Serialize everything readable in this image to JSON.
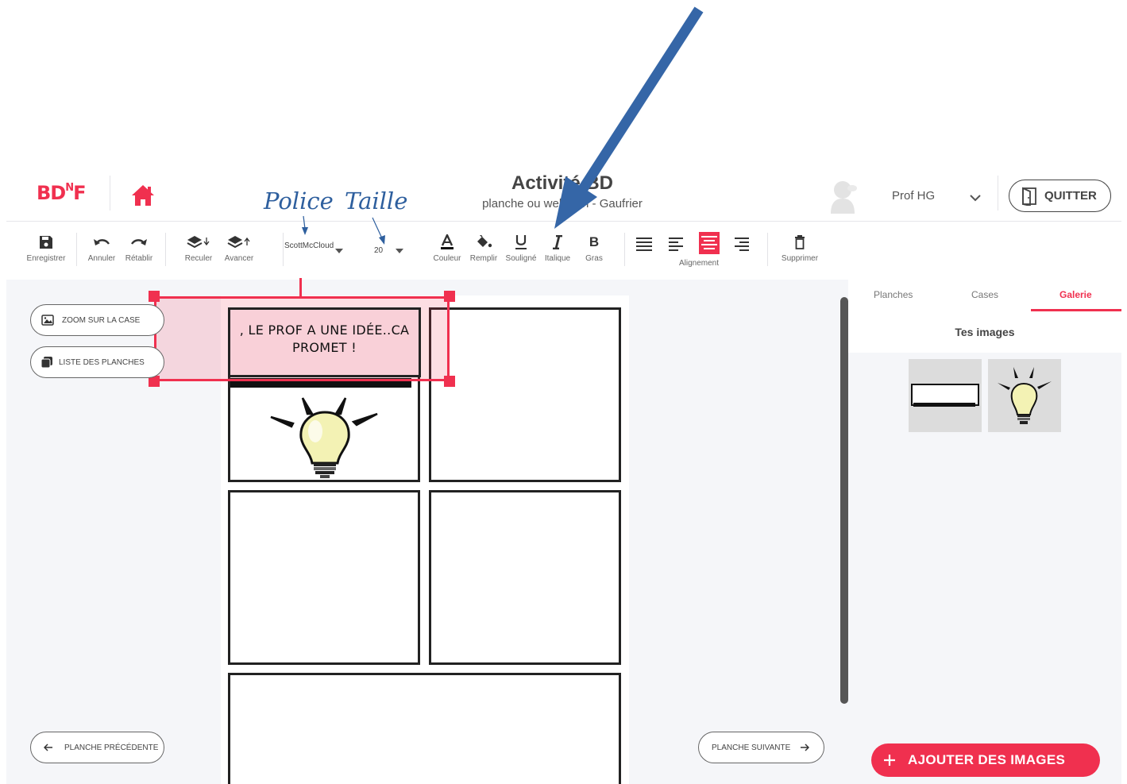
{
  "header": {
    "logo": "BDNF",
    "title": "Activité BD",
    "subtitle": "planche ou webtoon - Gaufrier",
    "user_name": "Prof HG",
    "quit_label": "QUITTER"
  },
  "toolbar": {
    "save": "Enregistrer",
    "undo": "Annuler",
    "redo": "Rétablir",
    "back": "Reculer",
    "forward": "Avancer",
    "font": "ScottMcCloud",
    "size": "20",
    "color": "Couleur",
    "fill": "Remplir",
    "underline": "Souligné",
    "italic": "Italique",
    "bold": "Gras",
    "alignment": "Alignement",
    "delete": "Supprimer"
  },
  "annotations": {
    "police": "Police",
    "taille": "Taille"
  },
  "workspace": {
    "zoom_button": "ZOOM SUR LA CASE",
    "list_button": "LISTE DES PLANCHES",
    "prev_button": "PLANCHE PRÉCÉDENTE",
    "next_button": "PLANCHE SUIVANTE",
    "bubble_text": ", LE PROF A UNE IDÉE..CA PROMET !"
  },
  "sidebar": {
    "tabs": [
      "Planches",
      "Cases",
      "Galerie"
    ],
    "active_tab": "Galerie",
    "gallery_title": "Tes images",
    "add_button": "AJOUTER DES IMAGES"
  },
  "colors": {
    "accent": "#f0304f",
    "arrow": "#2e5f9e",
    "panel_border": "#222222",
    "workspace_bg": "#f5f6f9"
  }
}
